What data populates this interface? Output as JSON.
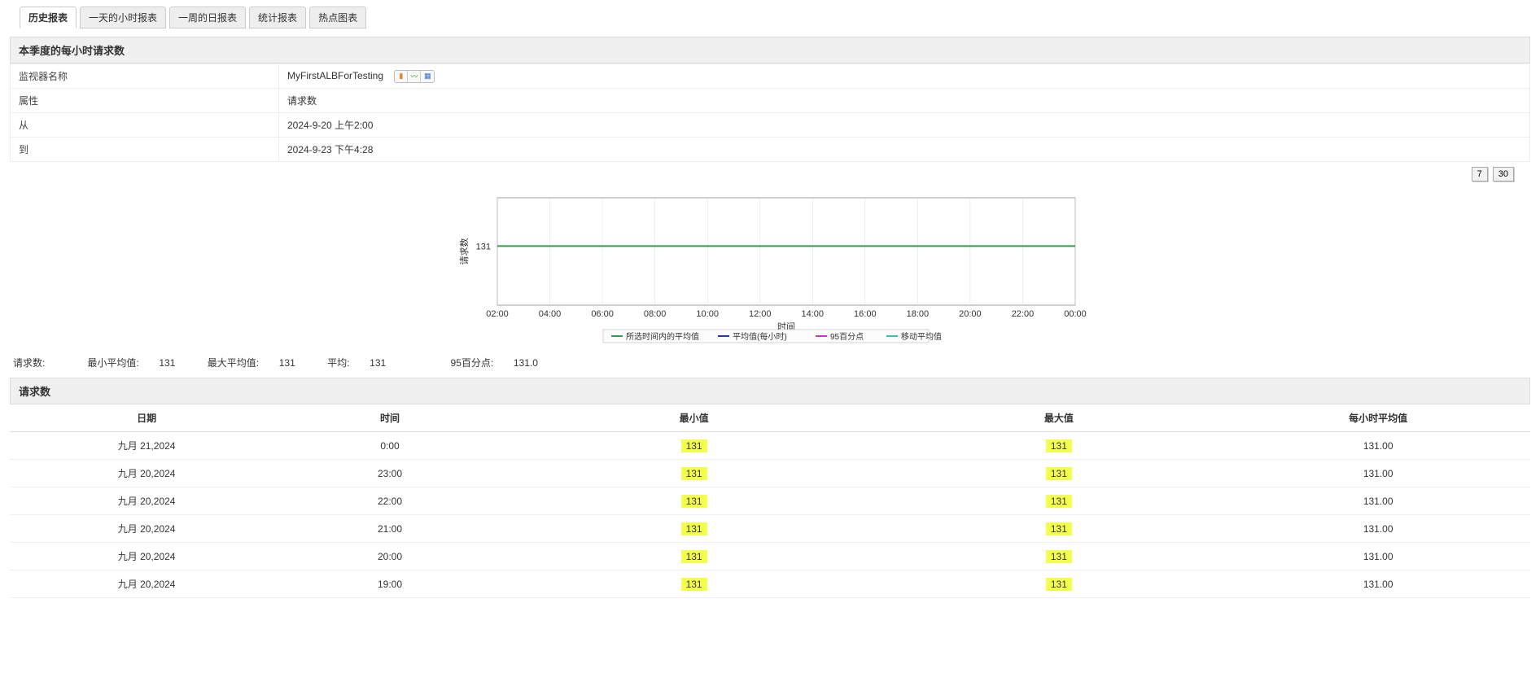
{
  "tabs": {
    "items": [
      "历史报表",
      "一天的小时报表",
      "一周的日报表",
      "统计报表",
      "热点图表"
    ],
    "active_index": 0
  },
  "section_title_1": "本季度的每小时请求数",
  "props": {
    "labels": {
      "monitor_name": "监视器名称",
      "attribute": "属性",
      "from": "从",
      "to": "到"
    },
    "monitor_name": "MyFirstALBForTesting",
    "attribute": "请求数",
    "from": "2024-9-20 上午2:00",
    "to": "2024-9-23 下午4:28"
  },
  "range_buttons": {
    "b7": "7",
    "b30": "30"
  },
  "chart_data": {
    "type": "line",
    "ylabel": "请求数",
    "xlabel": "时间",
    "y_ticks": [
      131
    ],
    "x_ticks": [
      "02:00",
      "04:00",
      "06:00",
      "08:00",
      "10:00",
      "12:00",
      "14:00",
      "16:00",
      "18:00",
      "20:00",
      "22:00",
      "00:00"
    ],
    "series": [
      {
        "name": "所选时间内的平均值",
        "color": "#359a4a",
        "value": 131
      },
      {
        "name": "平均值(每小时)",
        "color": "#1f3aa8"
      },
      {
        "name": "95百分点",
        "color": "#c038c5"
      },
      {
        "name": "移动平均值",
        "color": "#33c0c0"
      }
    ]
  },
  "summary": {
    "metric_label": "请求数:",
    "min_avg_label": "最小平均值:",
    "min_avg": "131",
    "max_avg_label": "最大平均值:",
    "max_avg": "131",
    "avg_label": "平均:",
    "avg": "131",
    "p95_label": "95百分点:",
    "p95": "131.0"
  },
  "section_title_2": "请求数",
  "table": {
    "headers": [
      "日期",
      "时间",
      "最小值",
      "最大值",
      "每小时平均值"
    ],
    "rows": [
      {
        "date": "九月 21,2024",
        "time": "0:00",
        "min": "131",
        "max": "131",
        "avg": "131.00"
      },
      {
        "date": "九月 20,2024",
        "time": "23:00",
        "min": "131",
        "max": "131",
        "avg": "131.00"
      },
      {
        "date": "九月 20,2024",
        "time": "22:00",
        "min": "131",
        "max": "131",
        "avg": "131.00"
      },
      {
        "date": "九月 20,2024",
        "time": "21:00",
        "min": "131",
        "max": "131",
        "avg": "131.00"
      },
      {
        "date": "九月 20,2024",
        "time": "20:00",
        "min": "131",
        "max": "131",
        "avg": "131.00"
      },
      {
        "date": "九月 20,2024",
        "time": "19:00",
        "min": "131",
        "max": "131",
        "avg": "131.00"
      }
    ]
  }
}
